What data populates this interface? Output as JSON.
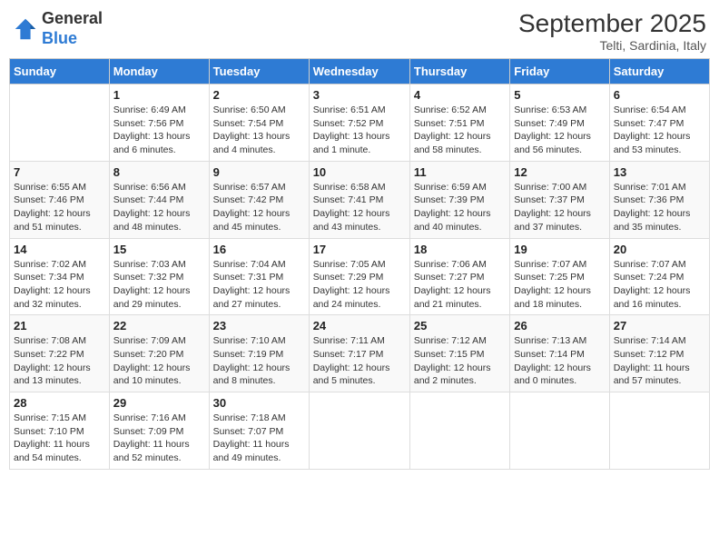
{
  "header": {
    "logo_line1": "General",
    "logo_line2": "Blue",
    "month_title": "September 2025",
    "location": "Telti, Sardinia, Italy"
  },
  "days_of_week": [
    "Sunday",
    "Monday",
    "Tuesday",
    "Wednesday",
    "Thursday",
    "Friday",
    "Saturday"
  ],
  "weeks": [
    [
      {
        "day": "",
        "sunrise": "",
        "sunset": "",
        "daylight": ""
      },
      {
        "day": "1",
        "sunrise": "Sunrise: 6:49 AM",
        "sunset": "Sunset: 7:56 PM",
        "daylight": "Daylight: 13 hours and 6 minutes."
      },
      {
        "day": "2",
        "sunrise": "Sunrise: 6:50 AM",
        "sunset": "Sunset: 7:54 PM",
        "daylight": "Daylight: 13 hours and 4 minutes."
      },
      {
        "day": "3",
        "sunrise": "Sunrise: 6:51 AM",
        "sunset": "Sunset: 7:52 PM",
        "daylight": "Daylight: 13 hours and 1 minute."
      },
      {
        "day": "4",
        "sunrise": "Sunrise: 6:52 AM",
        "sunset": "Sunset: 7:51 PM",
        "daylight": "Daylight: 12 hours and 58 minutes."
      },
      {
        "day": "5",
        "sunrise": "Sunrise: 6:53 AM",
        "sunset": "Sunset: 7:49 PM",
        "daylight": "Daylight: 12 hours and 56 minutes."
      },
      {
        "day": "6",
        "sunrise": "Sunrise: 6:54 AM",
        "sunset": "Sunset: 7:47 PM",
        "daylight": "Daylight: 12 hours and 53 minutes."
      }
    ],
    [
      {
        "day": "7",
        "sunrise": "Sunrise: 6:55 AM",
        "sunset": "Sunset: 7:46 PM",
        "daylight": "Daylight: 12 hours and 51 minutes."
      },
      {
        "day": "8",
        "sunrise": "Sunrise: 6:56 AM",
        "sunset": "Sunset: 7:44 PM",
        "daylight": "Daylight: 12 hours and 48 minutes."
      },
      {
        "day": "9",
        "sunrise": "Sunrise: 6:57 AM",
        "sunset": "Sunset: 7:42 PM",
        "daylight": "Daylight: 12 hours and 45 minutes."
      },
      {
        "day": "10",
        "sunrise": "Sunrise: 6:58 AM",
        "sunset": "Sunset: 7:41 PM",
        "daylight": "Daylight: 12 hours and 43 minutes."
      },
      {
        "day": "11",
        "sunrise": "Sunrise: 6:59 AM",
        "sunset": "Sunset: 7:39 PM",
        "daylight": "Daylight: 12 hours and 40 minutes."
      },
      {
        "day": "12",
        "sunrise": "Sunrise: 7:00 AM",
        "sunset": "Sunset: 7:37 PM",
        "daylight": "Daylight: 12 hours and 37 minutes."
      },
      {
        "day": "13",
        "sunrise": "Sunrise: 7:01 AM",
        "sunset": "Sunset: 7:36 PM",
        "daylight": "Daylight: 12 hours and 35 minutes."
      }
    ],
    [
      {
        "day": "14",
        "sunrise": "Sunrise: 7:02 AM",
        "sunset": "Sunset: 7:34 PM",
        "daylight": "Daylight: 12 hours and 32 minutes."
      },
      {
        "day": "15",
        "sunrise": "Sunrise: 7:03 AM",
        "sunset": "Sunset: 7:32 PM",
        "daylight": "Daylight: 12 hours and 29 minutes."
      },
      {
        "day": "16",
        "sunrise": "Sunrise: 7:04 AM",
        "sunset": "Sunset: 7:31 PM",
        "daylight": "Daylight: 12 hours and 27 minutes."
      },
      {
        "day": "17",
        "sunrise": "Sunrise: 7:05 AM",
        "sunset": "Sunset: 7:29 PM",
        "daylight": "Daylight: 12 hours and 24 minutes."
      },
      {
        "day": "18",
        "sunrise": "Sunrise: 7:06 AM",
        "sunset": "Sunset: 7:27 PM",
        "daylight": "Daylight: 12 hours and 21 minutes."
      },
      {
        "day": "19",
        "sunrise": "Sunrise: 7:07 AM",
        "sunset": "Sunset: 7:25 PM",
        "daylight": "Daylight: 12 hours and 18 minutes."
      },
      {
        "day": "20",
        "sunrise": "Sunrise: 7:07 AM",
        "sunset": "Sunset: 7:24 PM",
        "daylight": "Daylight: 12 hours and 16 minutes."
      }
    ],
    [
      {
        "day": "21",
        "sunrise": "Sunrise: 7:08 AM",
        "sunset": "Sunset: 7:22 PM",
        "daylight": "Daylight: 12 hours and 13 minutes."
      },
      {
        "day": "22",
        "sunrise": "Sunrise: 7:09 AM",
        "sunset": "Sunset: 7:20 PM",
        "daylight": "Daylight: 12 hours and 10 minutes."
      },
      {
        "day": "23",
        "sunrise": "Sunrise: 7:10 AM",
        "sunset": "Sunset: 7:19 PM",
        "daylight": "Daylight: 12 hours and 8 minutes."
      },
      {
        "day": "24",
        "sunrise": "Sunrise: 7:11 AM",
        "sunset": "Sunset: 7:17 PM",
        "daylight": "Daylight: 12 hours and 5 minutes."
      },
      {
        "day": "25",
        "sunrise": "Sunrise: 7:12 AM",
        "sunset": "Sunset: 7:15 PM",
        "daylight": "Daylight: 12 hours and 2 minutes."
      },
      {
        "day": "26",
        "sunrise": "Sunrise: 7:13 AM",
        "sunset": "Sunset: 7:14 PM",
        "daylight": "Daylight: 12 hours and 0 minutes."
      },
      {
        "day": "27",
        "sunrise": "Sunrise: 7:14 AM",
        "sunset": "Sunset: 7:12 PM",
        "daylight": "Daylight: 11 hours and 57 minutes."
      }
    ],
    [
      {
        "day": "28",
        "sunrise": "Sunrise: 7:15 AM",
        "sunset": "Sunset: 7:10 PM",
        "daylight": "Daylight: 11 hours and 54 minutes."
      },
      {
        "day": "29",
        "sunrise": "Sunrise: 7:16 AM",
        "sunset": "Sunset: 7:09 PM",
        "daylight": "Daylight: 11 hours and 52 minutes."
      },
      {
        "day": "30",
        "sunrise": "Sunrise: 7:18 AM",
        "sunset": "Sunset: 7:07 PM",
        "daylight": "Daylight: 11 hours and 49 minutes."
      },
      {
        "day": "",
        "sunrise": "",
        "sunset": "",
        "daylight": ""
      },
      {
        "day": "",
        "sunrise": "",
        "sunset": "",
        "daylight": ""
      },
      {
        "day": "",
        "sunrise": "",
        "sunset": "",
        "daylight": ""
      },
      {
        "day": "",
        "sunrise": "",
        "sunset": "",
        "daylight": ""
      }
    ]
  ]
}
